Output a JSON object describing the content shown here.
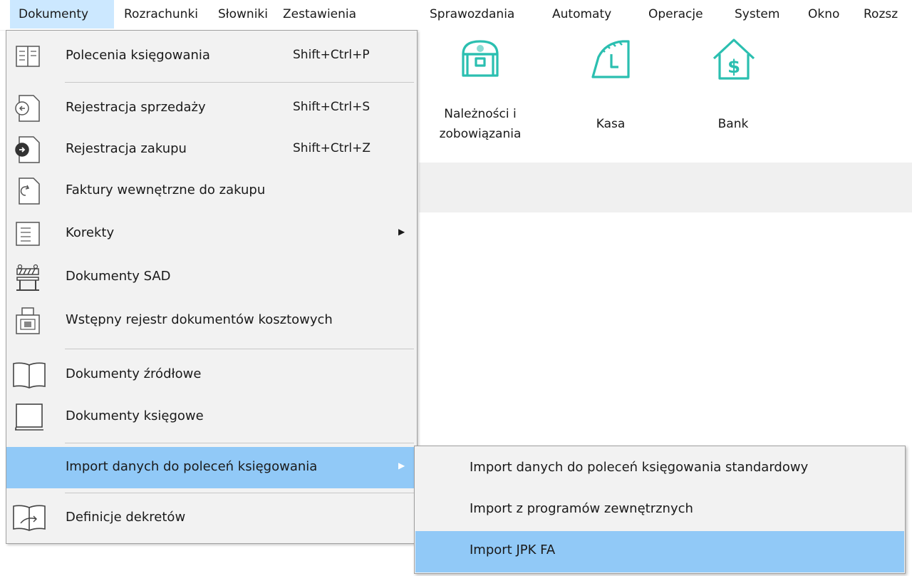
{
  "menubar": {
    "items": [
      {
        "label": "Dokumenty"
      },
      {
        "label": "Rozrachunki"
      },
      {
        "label": "Słowniki"
      },
      {
        "label": "Zestawienia"
      },
      {
        "label": "Sprawozdania"
      },
      {
        "label": "Automaty"
      },
      {
        "label": "Operacje"
      },
      {
        "label": "System"
      },
      {
        "label": "Okno"
      },
      {
        "label": "Rozsz"
      }
    ]
  },
  "toolbar": {
    "buttons": [
      {
        "label_line1": "Należności i",
        "label_line2": "zobowiązania",
        "icon": "treasure-chest-icon"
      },
      {
        "label": "Kasa",
        "icon": "cash-register-icon"
      },
      {
        "label": "Bank",
        "icon": "bank-icon"
      }
    ]
  },
  "menu": {
    "items": [
      {
        "label": "Polecenia księgowania",
        "shortcut": "Shift+Ctrl+P",
        "icon": "journal-entries-icon"
      },
      {
        "label": "Rejestracja sprzedaży",
        "shortcut": "Shift+Ctrl+S",
        "icon": "sales-document-icon"
      },
      {
        "label": "Rejestracja zakupu",
        "shortcut": "Shift+Ctrl+Z",
        "icon": "purchase-document-icon"
      },
      {
        "label": "Faktury wewnętrzne do zakupu",
        "icon": "internal-invoice-icon"
      },
      {
        "label": "Korekty",
        "icon": "corrections-icon"
      },
      {
        "label": "Dokumenty SAD",
        "icon": "customs-barrier-icon"
      },
      {
        "label": "Wstępny rejestr dokumentów kosztowych",
        "icon": "scanner-icon"
      },
      {
        "label": "Dokumenty źródłowe",
        "icon": "open-book-icon"
      },
      {
        "label": "Dokumenty księgowe",
        "icon": "closed-book-icon"
      },
      {
        "label": "Import danych do poleceń księgowania"
      },
      {
        "label": "Definicje dekretów",
        "icon": "decree-book-icon"
      }
    ]
  },
  "submenu": {
    "items": [
      {
        "label": "Import danych do poleceń księgowania standardowy"
      },
      {
        "label": "Import z programów zewnętrznych"
      },
      {
        "label": "Import JPK FA"
      }
    ]
  },
  "colors": {
    "accent_teal": "#2bbfb0",
    "highlight": "#91c9f7",
    "menu_bg": "#f2f2f2"
  }
}
